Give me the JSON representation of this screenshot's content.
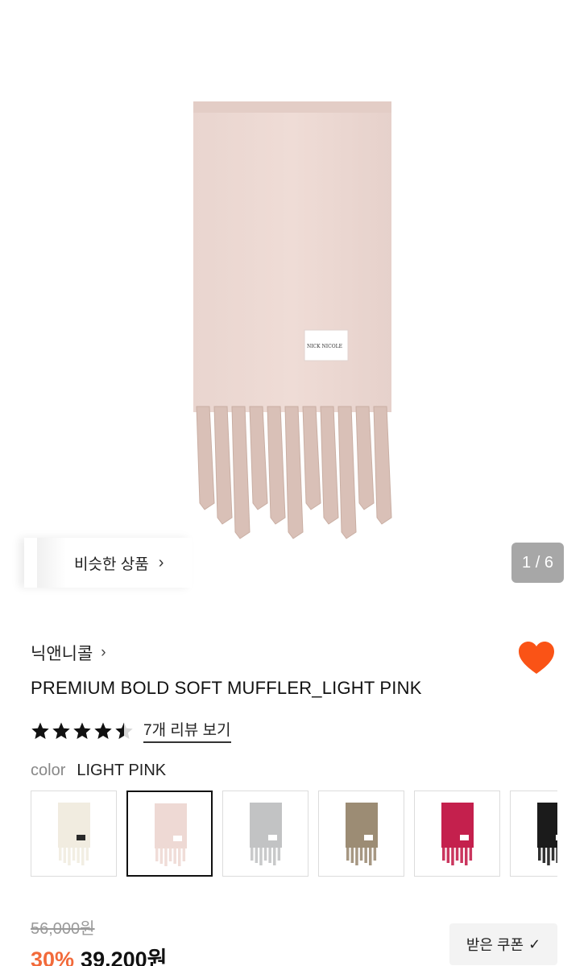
{
  "gallery": {
    "logo_text": "NICK NICOLE",
    "similar_label": "비슷한 상품",
    "counter": "1 / 6",
    "current_image": 1,
    "total_images": 6
  },
  "product": {
    "brand": "닉앤니콜",
    "name": "PREMIUM BOLD SOFT MUFFLER_LIGHT PINK",
    "rating": 4.5,
    "review_link": "7개 리뷰 보기",
    "favorited": true
  },
  "color": {
    "label": "color",
    "selected": "LIGHT PINK",
    "options": [
      {
        "color": "#f1ece0"
      },
      {
        "color": "#eed9d4"
      },
      {
        "color": "#c2c3c4"
      },
      {
        "color": "#9c8c74"
      },
      {
        "color": "#c4204d"
      },
      {
        "color": "#1b1b1b"
      }
    ],
    "selected_index": 1
  },
  "pricing": {
    "original": "56,000원",
    "discount": "30%",
    "final": "39,200원",
    "coupon_label": "받은 쿠폰",
    "coupon_check": "✓"
  },
  "colors": {
    "accent": "#f26a3a",
    "heart": "#fa5316",
    "scarf": "#ecd9d3",
    "counter_bg": "#a7a7a7"
  }
}
